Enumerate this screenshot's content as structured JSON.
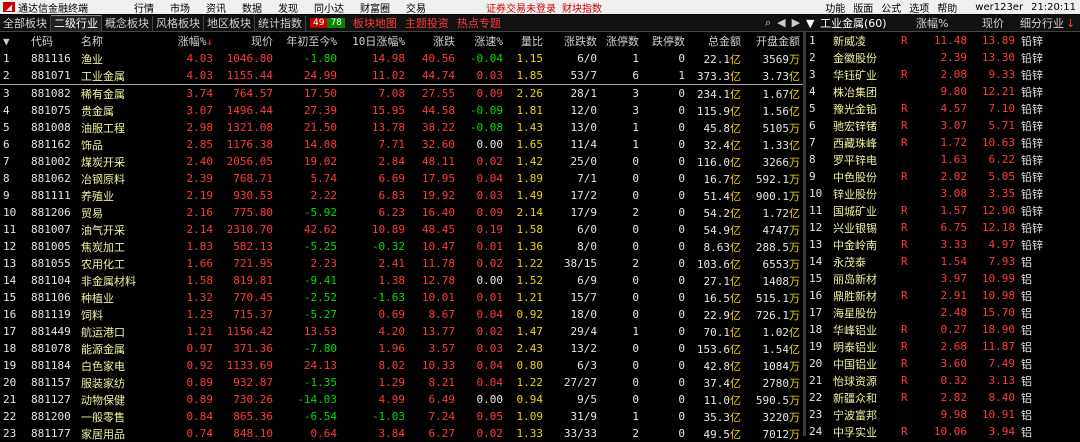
{
  "menubar": {
    "app_title": "通达信金融终端",
    "menus": [
      "行情",
      "市场",
      "资讯",
      "数据",
      "发现",
      "同小达",
      "财富圈",
      "交易"
    ],
    "notice1": "证券交易未登录",
    "notice2": "财块指数",
    "right_items": [
      "功能",
      "版面",
      "公式",
      "选项",
      "帮助"
    ],
    "user": "wer123er",
    "time": "21:20:11"
  },
  "tabs": {
    "items": [
      "全部板块",
      "二级行业",
      "概念板块",
      "风格板块",
      "地区板块",
      "统计指数"
    ],
    "active_index": 1,
    "up_count": "49",
    "down_count": "78",
    "map_label": "板块地图",
    "theme_label": "主题投资",
    "hot_label": "热点专题",
    "search_glyph": "🔍"
  },
  "right_header": {
    "title": "工业金属(60)",
    "col_change": "涨幅%",
    "col_price": "现价",
    "col_sub": "细分行业"
  },
  "table": {
    "headers": [
      "代码",
      "名称",
      "涨幅%",
      "现价",
      "年初至今%",
      "10日涨幅%",
      "涨跌",
      "涨速%",
      "量比",
      "涨跌数",
      "涨停数",
      "跌停数",
      "总金额",
      "开盘金额"
    ],
    "rows": [
      {
        "idx": "1",
        "code": "881116",
        "name": "渔业",
        "chg": "4.03",
        "price": "1046.80",
        "ytd": "-1.80",
        "d10": "14.98",
        "diff": "40.56",
        "speed": "-0.04",
        "vr": "1.15",
        "ud": "6/0",
        "zt": "1",
        "dt": "0",
        "amt": "22.1",
        "amt_u": "亿",
        "open": "3569",
        "open_u": "万"
      },
      {
        "idx": "2",
        "code": "881071",
        "name": "工业金属",
        "chg": "4.03",
        "price": "1155.44",
        "ytd": "24.99",
        "d10": "11.02",
        "diff": "44.74",
        "speed": "0.03",
        "vr": "1.85",
        "ud": "53/7",
        "zt": "6",
        "dt": "1",
        "amt": "373.3",
        "amt_u": "亿",
        "open": "3.73",
        "open_u": "亿"
      },
      {
        "idx": "3",
        "code": "881082",
        "name": "稀有金属",
        "chg": "3.74",
        "price": "764.57",
        "ytd": "17.50",
        "d10": "7.08",
        "diff": "27.55",
        "speed": "0.09",
        "vr": "2.26",
        "ud": "28/1",
        "zt": "3",
        "dt": "0",
        "amt": "234.1",
        "amt_u": "亿",
        "open": "1.67",
        "open_u": "亿"
      },
      {
        "idx": "4",
        "code": "881075",
        "name": "贵金属",
        "chg": "3.07",
        "price": "1496.44",
        "ytd": "27.39",
        "d10": "15.95",
        "diff": "44.58",
        "speed": "-0.09",
        "vr": "1.81",
        "ud": "12/0",
        "zt": "3",
        "dt": "0",
        "amt": "115.9",
        "amt_u": "亿",
        "open": "1.56",
        "open_u": "亿"
      },
      {
        "idx": "5",
        "code": "881008",
        "name": "油服工程",
        "chg": "2.98",
        "price": "1321.08",
        "ytd": "21.50",
        "d10": "13.78",
        "diff": "38.22",
        "speed": "-0.08",
        "vr": "1.43",
        "ud": "13/0",
        "zt": "1",
        "dt": "0",
        "amt": "45.8",
        "amt_u": "亿",
        "open": "5105",
        "open_u": "万"
      },
      {
        "idx": "6",
        "code": "881162",
        "name": "饰品",
        "chg": "2.85",
        "price": "1176.38",
        "ytd": "14.08",
        "d10": "7.71",
        "diff": "32.60",
        "speed": "0.00",
        "vr": "1.65",
        "ud": "11/4",
        "zt": "1",
        "dt": "0",
        "amt": "32.4",
        "amt_u": "亿",
        "open": "1.33",
        "open_u": "亿"
      },
      {
        "idx": "7",
        "code": "881002",
        "name": "煤炭开采",
        "chg": "2.40",
        "price": "2056.05",
        "ytd": "19.02",
        "d10": "2.84",
        "diff": "48.11",
        "speed": "0.02",
        "vr": "1.42",
        "ud": "25/0",
        "zt": "0",
        "dt": "0",
        "amt": "116.0",
        "amt_u": "亿",
        "open": "3266",
        "open_u": "万"
      },
      {
        "idx": "8",
        "code": "881062",
        "name": "冶钢原料",
        "chg": "2.39",
        "price": "768.71",
        "ytd": "5.74",
        "d10": "6.69",
        "diff": "17.95",
        "speed": "0.04",
        "vr": "1.89",
        "ud": "7/1",
        "zt": "0",
        "dt": "0",
        "amt": "16.7",
        "amt_u": "亿",
        "open": "592.1",
        "open_u": "万"
      },
      {
        "idx": "9",
        "code": "881111",
        "name": "养殖业",
        "chg": "2.19",
        "price": "930.53",
        "ytd": "2.22",
        "d10": "6.83",
        "diff": "19.92",
        "speed": "0.03",
        "vr": "1.49",
        "ud": "17/2",
        "zt": "0",
        "dt": "0",
        "amt": "51.4",
        "amt_u": "亿",
        "open": "900.1",
        "open_u": "万"
      },
      {
        "idx": "10",
        "code": "881206",
        "name": "贸易",
        "chg": "2.16",
        "price": "775.80",
        "ytd": "-5.92",
        "d10": "6.23",
        "diff": "16.40",
        "speed": "0.09",
        "vr": "2.14",
        "ud": "17/9",
        "zt": "2",
        "dt": "0",
        "amt": "54.2",
        "amt_u": "亿",
        "open": "1.72",
        "open_u": "亿"
      },
      {
        "idx": "11",
        "code": "881007",
        "name": "油气开采",
        "chg": "2.14",
        "price": "2310.70",
        "ytd": "42.62",
        "d10": "10.89",
        "diff": "48.45",
        "speed": "0.19",
        "vr": "1.58",
        "ud": "6/0",
        "zt": "0",
        "dt": "0",
        "amt": "54.9",
        "amt_u": "亿",
        "open": "4747",
        "open_u": "万"
      },
      {
        "idx": "12",
        "code": "881005",
        "name": "焦炭加工",
        "chg": "1.83",
        "price": "582.13",
        "ytd": "-5.25",
        "d10": "-0.32",
        "diff": "10.47",
        "speed": "0.01",
        "vr": "1.36",
        "ud": "8/0",
        "zt": "0",
        "dt": "0",
        "amt": "8.63",
        "amt_u": "亿",
        "open": "288.5",
        "open_u": "万"
      },
      {
        "idx": "13",
        "code": "881055",
        "name": "农用化工",
        "chg": "1.66",
        "price": "721.95",
        "ytd": "2.23",
        "d10": "2.41",
        "diff": "11.78",
        "speed": "0.02",
        "vr": "1.22",
        "ud": "38/15",
        "zt": "2",
        "dt": "0",
        "amt": "103.6",
        "amt_u": "亿",
        "open": "6553",
        "open_u": "万"
      },
      {
        "idx": "14",
        "code": "881104",
        "name": "非金属材料",
        "chg": "1.58",
        "price": "819.81",
        "ytd": "-9.41",
        "d10": "1.38",
        "diff": "12.78",
        "speed": "0.00",
        "vr": "1.52",
        "ud": "6/9",
        "zt": "0",
        "dt": "0",
        "amt": "27.1",
        "amt_u": "亿",
        "open": "1408",
        "open_u": "万"
      },
      {
        "idx": "15",
        "code": "881106",
        "name": "种植业",
        "chg": "1.32",
        "price": "770.45",
        "ytd": "-2.52",
        "d10": "-1.63",
        "diff": "10.01",
        "speed": "0.01",
        "vr": "1.21",
        "ud": "15/7",
        "zt": "0",
        "dt": "0",
        "amt": "16.5",
        "amt_u": "亿",
        "open": "515.1",
        "open_u": "万"
      },
      {
        "idx": "16",
        "code": "881119",
        "name": "饲料",
        "chg": "1.23",
        "price": "715.37",
        "ytd": "-5.27",
        "d10": "0.69",
        "diff": "8.67",
        "speed": "0.04",
        "vr": "0.92",
        "ud": "18/0",
        "zt": "0",
        "dt": "0",
        "amt": "22.9",
        "amt_u": "亿",
        "open": "726.1",
        "open_u": "万"
      },
      {
        "idx": "17",
        "code": "881449",
        "name": "航运港口",
        "chg": "1.21",
        "price": "1156.42",
        "ytd": "13.53",
        "d10": "4.20",
        "diff": "13.77",
        "speed": "0.02",
        "vr": "1.47",
        "ud": "29/4",
        "zt": "1",
        "dt": "0",
        "amt": "70.1",
        "amt_u": "亿",
        "open": "1.02",
        "open_u": "亿"
      },
      {
        "idx": "18",
        "code": "881078",
        "name": "能源金属",
        "chg": "0.97",
        "price": "371.36",
        "ytd": "-7.80",
        "d10": "1.96",
        "diff": "3.57",
        "speed": "0.03",
        "vr": "2.43",
        "ud": "13/2",
        "zt": "0",
        "dt": "0",
        "amt": "153.6",
        "amt_u": "亿",
        "open": "1.54",
        "open_u": "亿"
      },
      {
        "idx": "19",
        "code": "881184",
        "name": "白色家电",
        "chg": "0.92",
        "price": "1133.69",
        "ytd": "24.13",
        "d10": "8.02",
        "diff": "10.33",
        "speed": "0.04",
        "vr": "0.80",
        "ud": "6/3",
        "zt": "0",
        "dt": "0",
        "amt": "42.8",
        "amt_u": "亿",
        "open": "1084",
        "open_u": "万"
      },
      {
        "idx": "20",
        "code": "881157",
        "name": "服装家纺",
        "chg": "0.89",
        "price": "932.87",
        "ytd": "-1.35",
        "d10": "1.29",
        "diff": "8.21",
        "speed": "0.04",
        "vr": "1.22",
        "ud": "27/27",
        "zt": "0",
        "dt": "0",
        "amt": "37.4",
        "amt_u": "亿",
        "open": "2780",
        "open_u": "万"
      },
      {
        "idx": "21",
        "code": "881127",
        "name": "动物保健",
        "chg": "0.89",
        "price": "730.26",
        "ytd": "-14.03",
        "d10": "4.99",
        "diff": "6.49",
        "speed": "0.00",
        "vr": "0.94",
        "ud": "9/5",
        "zt": "0",
        "dt": "0",
        "amt": "11.0",
        "amt_u": "亿",
        "open": "590.5",
        "open_u": "万"
      },
      {
        "idx": "22",
        "code": "881200",
        "name": "一般零售",
        "chg": "0.84",
        "price": "865.36",
        "ytd": "-6.54",
        "d10": "-1.03",
        "diff": "7.24",
        "speed": "0.05",
        "vr": "1.09",
        "ud": "31/9",
        "zt": "1",
        "dt": "0",
        "amt": "35.3",
        "amt_u": "亿",
        "open": "3220",
        "open_u": "万"
      },
      {
        "idx": "23",
        "code": "881177",
        "name": "家居用品",
        "chg": "0.74",
        "price": "848.10",
        "ytd": "0.64",
        "d10": "3.84",
        "diff": "6.27",
        "speed": "0.02",
        "vr": "1.33",
        "ud": "33/33",
        "zt": "2",
        "dt": "0",
        "amt": "49.5",
        "amt_u": "亿",
        "open": "7012",
        "open_u": "万"
      }
    ]
  },
  "right_rows": [
    {
      "idx": "1",
      "name": "新威凌",
      "tag": "R",
      "chg": "11.48",
      "price": "13.89",
      "sub": "铅锌"
    },
    {
      "idx": "2",
      "name": "金徽股份",
      "tag": "",
      "chg": "2.39",
      "price": "13.30",
      "sub": "铅锌"
    },
    {
      "idx": "3",
      "name": "华钰矿业",
      "tag": "R",
      "chg": "2.08",
      "price": "9.33",
      "sub": "铅锌"
    },
    {
      "idx": "4",
      "name": "株冶集团",
      "tag": "",
      "chg": "9.80",
      "price": "12.21",
      "sub": "铅锌"
    },
    {
      "idx": "5",
      "name": "豫光金铅",
      "tag": "R",
      "chg": "4.57",
      "price": "7.10",
      "sub": "铅锌"
    },
    {
      "idx": "6",
      "name": "驰宏锌锗",
      "tag": "R",
      "chg": "3.07",
      "price": "5.71",
      "sub": "铅锌"
    },
    {
      "idx": "7",
      "name": "西藏珠峰",
      "tag": "R",
      "chg": "1.72",
      "price": "10.63",
      "sub": "铅锌"
    },
    {
      "idx": "8",
      "name": "罗平锌电",
      "tag": "",
      "chg": "1.63",
      "price": "6.22",
      "sub": "铅锌"
    },
    {
      "idx": "9",
      "name": "中色股份",
      "tag": "R",
      "chg": "2.02",
      "price": "5.05",
      "sub": "铅锌"
    },
    {
      "idx": "10",
      "name": "锌业股份",
      "tag": "",
      "chg": "3.08",
      "price": "3.35",
      "sub": "铅锌"
    },
    {
      "idx": "11",
      "name": "国城矿业",
      "tag": "R",
      "chg": "1.57",
      "price": "12.90",
      "sub": "铅锌"
    },
    {
      "idx": "12",
      "name": "兴业银锡",
      "tag": "R",
      "chg": "6.75",
      "price": "12.18",
      "sub": "铅锌"
    },
    {
      "idx": "13",
      "name": "中金岭南",
      "tag": "R",
      "chg": "3.33",
      "price": "4.97",
      "sub": "铅锌"
    },
    {
      "idx": "14",
      "name": "永茂泰",
      "tag": "R",
      "chg": "1.54",
      "price": "7.93",
      "sub": "铝"
    },
    {
      "idx": "15",
      "name": "丽岛新材",
      "tag": "",
      "chg": "3.97",
      "price": "10.99",
      "sub": "铝"
    },
    {
      "idx": "16",
      "name": "鼎胜新材",
      "tag": "R",
      "chg": "2.91",
      "price": "10.98",
      "sub": "铝"
    },
    {
      "idx": "17",
      "name": "海星股份",
      "tag": "",
      "chg": "2.48",
      "price": "15.70",
      "sub": "铝"
    },
    {
      "idx": "18",
      "name": "华峰铝业",
      "tag": "R",
      "chg": "0.27",
      "price": "18.90",
      "sub": "铝"
    },
    {
      "idx": "19",
      "name": "明泰铝业",
      "tag": "R",
      "chg": "2.68",
      "price": "11.87",
      "sub": "铝"
    },
    {
      "idx": "20",
      "name": "中国铝业",
      "tag": "R",
      "chg": "3.60",
      "price": "7.49",
      "sub": "铝"
    },
    {
      "idx": "21",
      "name": "怡球资源",
      "tag": "R",
      "chg": "0.32",
      "price": "3.13",
      "sub": "铝"
    },
    {
      "idx": "22",
      "name": "新疆众和",
      "tag": "R",
      "chg": "2.82",
      "price": "8.40",
      "sub": "铝"
    },
    {
      "idx": "23",
      "name": "宁波富邦",
      "tag": "",
      "chg": "9.98",
      "price": "10.91",
      "sub": "铝"
    },
    {
      "idx": "24",
      "name": "中孚实业",
      "tag": "R",
      "chg": "10.06",
      "price": "3.94",
      "sub": "铝"
    }
  ],
  "colors": {
    "up": "#ff3b3b",
    "down": "#00dd00",
    "neutral": "#e6e6e6",
    "unit": "#f0d400",
    "background": "#000000"
  }
}
